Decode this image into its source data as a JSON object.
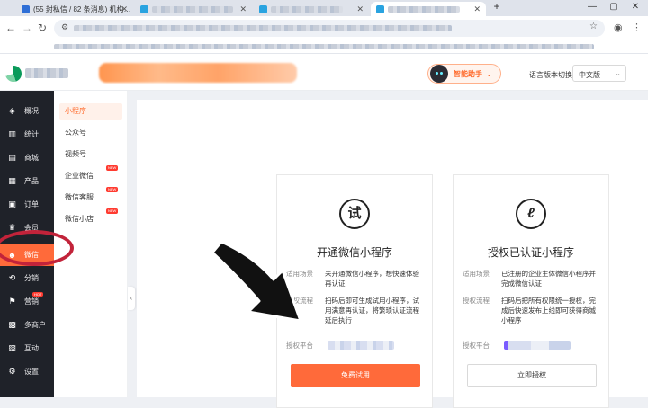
{
  "browser": {
    "tabs": [
      {
        "title": "(55 封私信 / 82 条消息) 机构…"
      },
      {
        "title": ""
      },
      {
        "title": ""
      },
      {
        "title": ""
      }
    ],
    "new_tab": "+",
    "win_min": "—",
    "win_max": "▢",
    "win_close": "✕"
  },
  "header": {
    "assistant_label": "智能助手",
    "lang_label": "语言版本切换：",
    "lang_value": "中文版"
  },
  "sidebar": {
    "items": [
      {
        "label": "概况",
        "icon": "layers-icon"
      },
      {
        "label": "统计",
        "icon": "bar-chart-icon"
      },
      {
        "label": "商城",
        "icon": "store-icon"
      },
      {
        "label": "产品",
        "icon": "grid-icon"
      },
      {
        "label": "订单",
        "icon": "order-icon"
      },
      {
        "label": "会员",
        "icon": "member-icon"
      },
      {
        "label": "微信",
        "icon": "wechat-icon"
      },
      {
        "label": "分销",
        "icon": "share-icon"
      },
      {
        "label": "营销",
        "icon": "flag-icon",
        "badge": "HOT"
      },
      {
        "label": "多商户",
        "icon": "merchant-icon"
      },
      {
        "label": "互动",
        "icon": "interact-icon"
      },
      {
        "label": "设置",
        "icon": "gear-icon"
      }
    ],
    "active_index": 6
  },
  "submenu": {
    "items": [
      {
        "label": "小程序"
      },
      {
        "label": "公众号"
      },
      {
        "label": "视频号"
      },
      {
        "label": "企业微信",
        "badge": "NEW"
      },
      {
        "label": "微信客服",
        "badge": "NEW"
      },
      {
        "label": "微信小店",
        "badge": "NEW"
      }
    ],
    "collapse": "‹"
  },
  "cards": [
    {
      "icon_char": "试",
      "title": "开通微信小程序",
      "scene_label": "适用场景",
      "scene_text": "未开通微信小程序，想快速体验再认证",
      "flow_label": "授权流程",
      "flow_text": "扫码后即可生成试用小程序，试用满意再认证，将繁琐认证流程延后执行",
      "platform_label": "授权平台",
      "button": "免费试用"
    },
    {
      "icon_char": "ℓ",
      "title": "授权已认证小程序",
      "scene_label": "适用场景",
      "scene_text": "已注册的企业主体微信小程序并完成微信认证",
      "flow_label": "授权流程",
      "flow_text": "扫码后把所有权限统一授权，完成后快速发布上线即可获得商城小程序",
      "platform_label": "授权平台",
      "button": "立即授权"
    }
  ],
  "colors": {
    "accent": "#ff6a3a",
    "sidebar_bg": "#1f2229",
    "annotation_ring": "#c2233a"
  }
}
